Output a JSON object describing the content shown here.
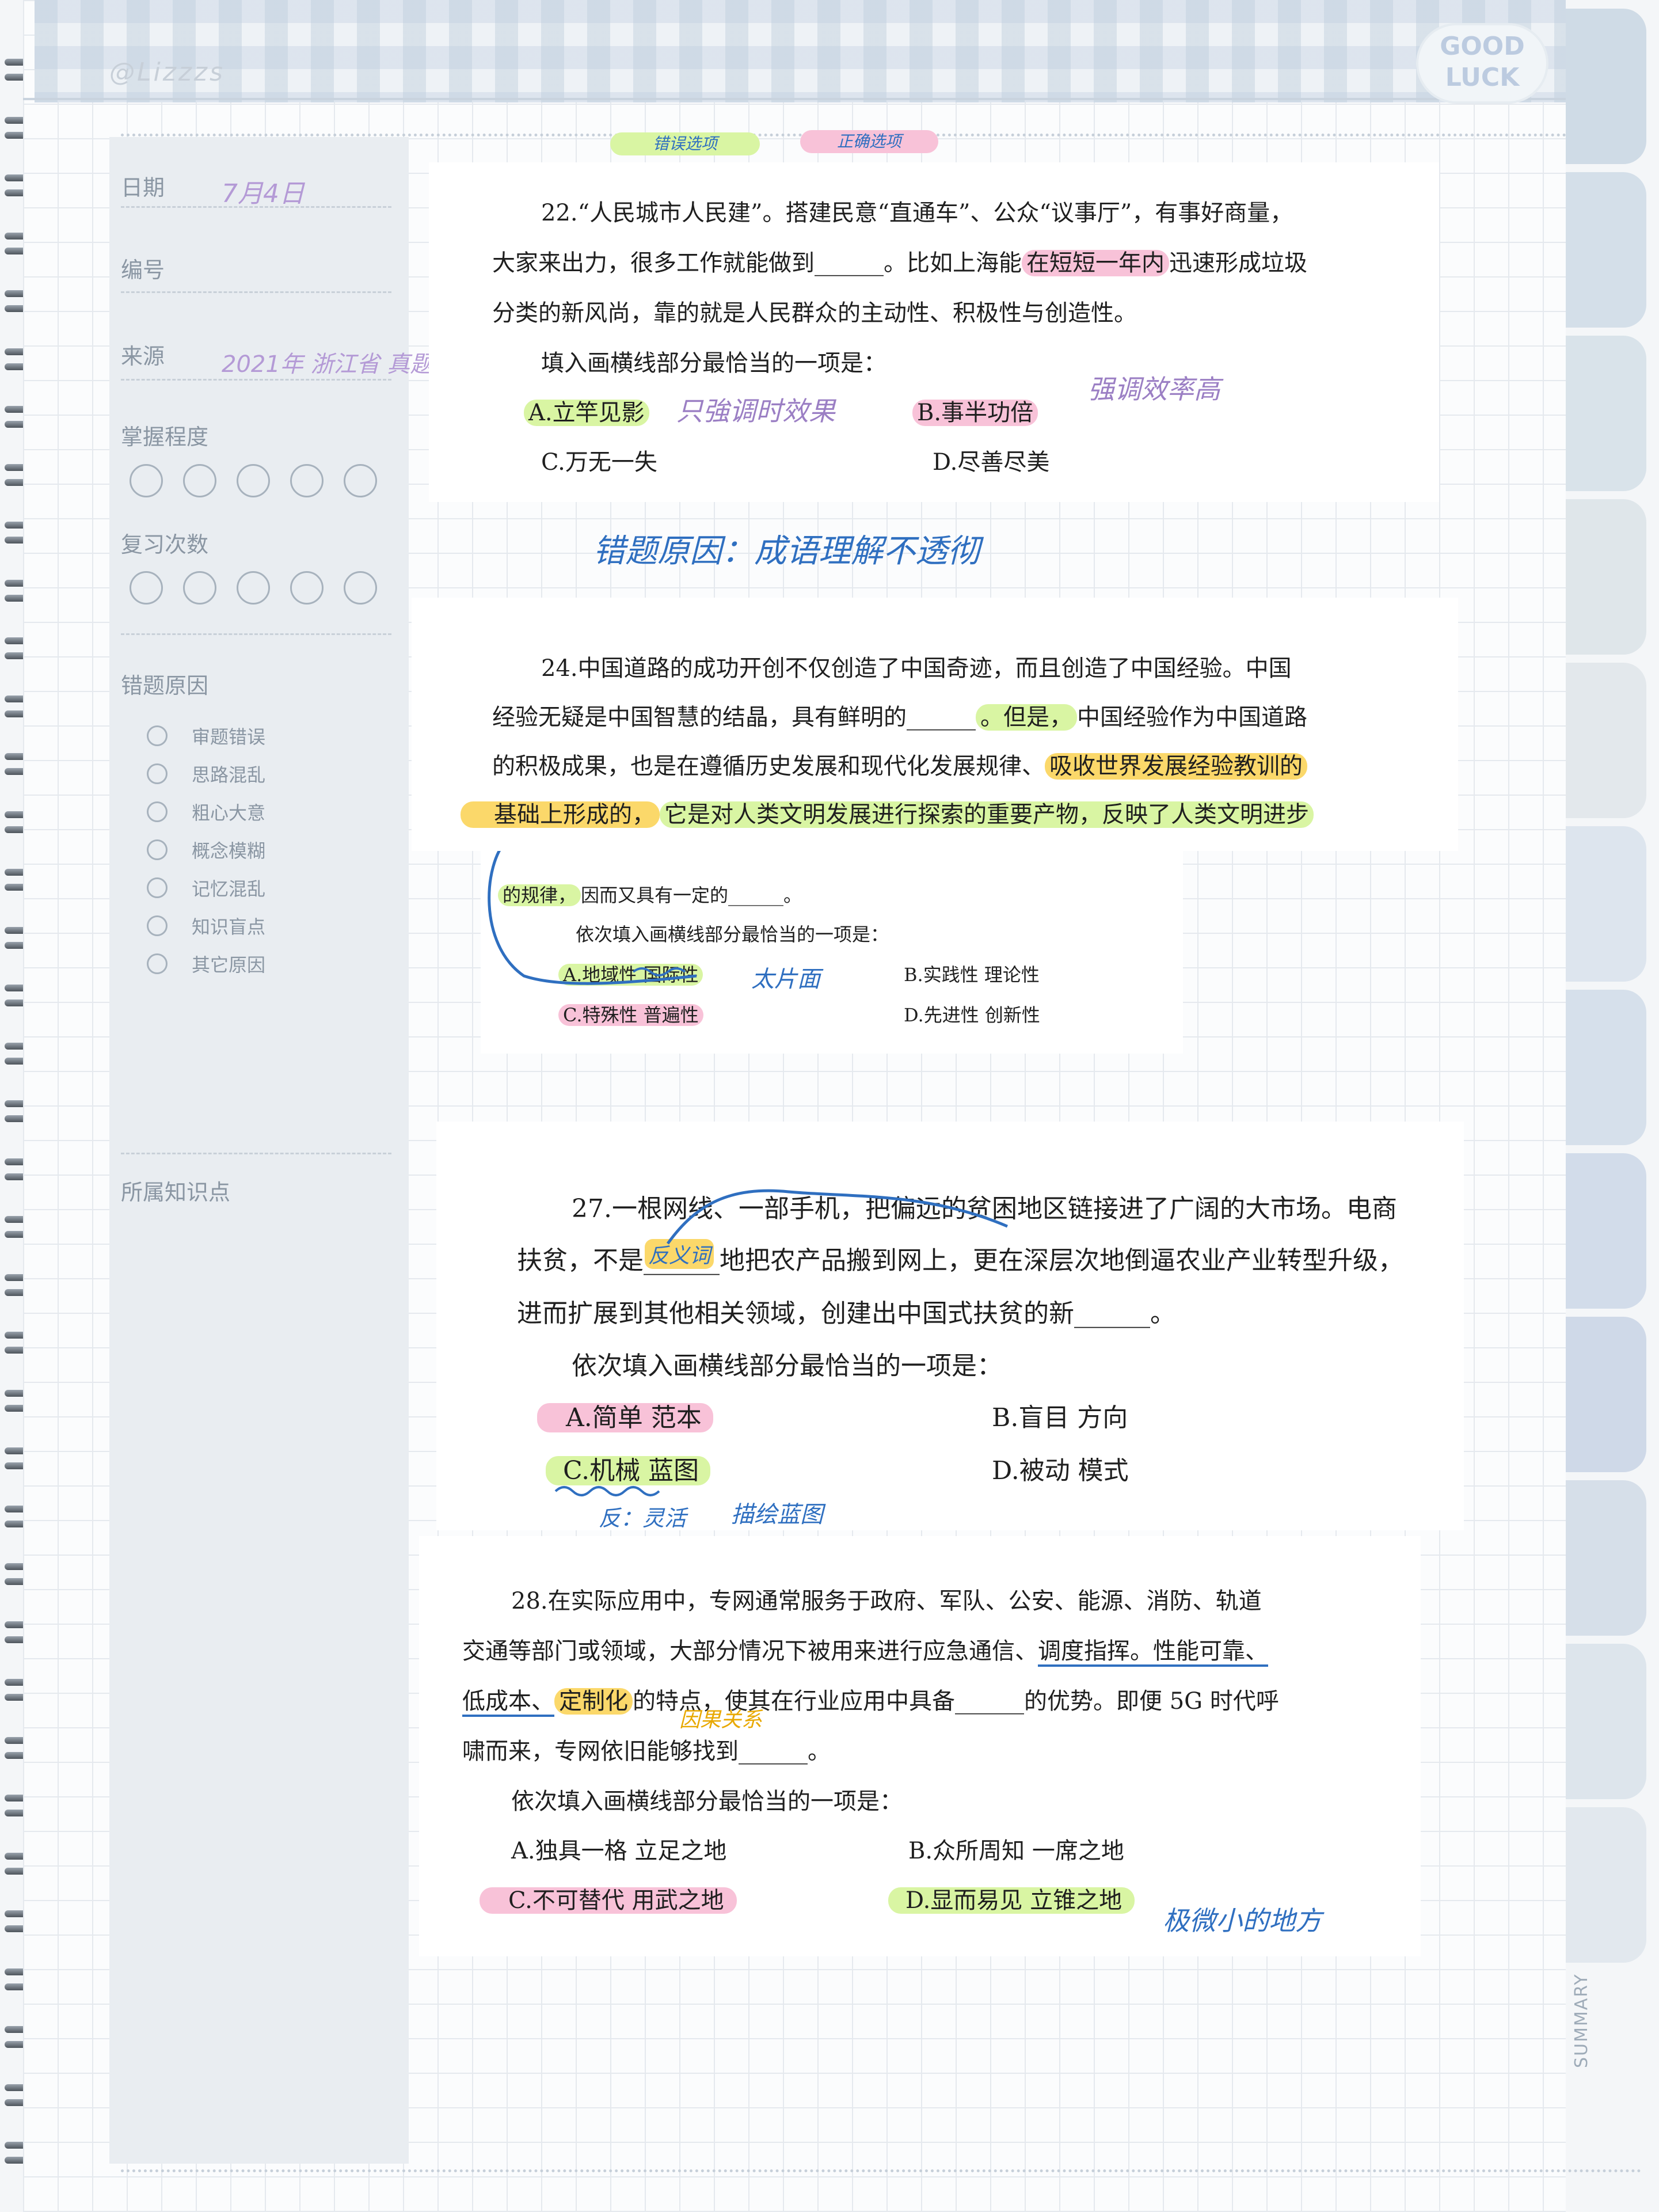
{
  "header": {
    "watermark": "@Lizzzs",
    "sticker": "GOOD LUCK",
    "legend": {
      "wrong_option": "错误选项",
      "correct_option": "正确选项"
    }
  },
  "sidebar": {
    "date_label": "日期",
    "date_value": "7月4日",
    "number_label": "编号",
    "source_label": "来源",
    "source_value": "2021年 浙江省 真题",
    "mastery_label": "掌握程度",
    "review_label": "复习次数",
    "reason_label": "错题原因",
    "reasons": [
      "审题错误",
      "思路混乱",
      "粗心大意",
      "概念模糊",
      "记忆混乱",
      "知识盲点",
      "其它原因"
    ],
    "knowledge_label": "所属知识点"
  },
  "q22": {
    "stem1": "22.“人民城市人民建”。搭建民意“直通车”、公众“议事厅”，有事好商量，",
    "stem2a": "大家来出力，很多工作就能做到______。比如上海能",
    "stem2hl": "在短短一年内",
    "stem2b": "迅速形成垃圾",
    "stem3": "分类的新风尚，靠的就是人民群众的主动性、积极性与创造性。",
    "prompt": "填入画横线部分最恰当的一项是：",
    "optA": "A.立竿见影",
    "optB": "B.事半功倍",
    "optC": "C.万无一失",
    "optD": "D.尽善尽美",
    "noteA": "只強调时效果",
    "noteB": "强调效率高",
    "wrong_reason": "错题原因：成语理解不透彻"
  },
  "q24": {
    "stem1": "24.中国道路的成功开创不仅创造了中国奇迹，而且创造了中国经验。中国",
    "stem2a": "经验无疑是中国智慧的结晶，具有鲜明的______",
    "stem2hl": "。但是，",
    "stem2b": "中国经验作为中国道路",
    "stem3a": "的积极成果，也是在遵循历史发展和现代化发展规律、",
    "stem3hl": "吸收世界发展经验教训的",
    "stem4y": "基础上形成的，",
    "stem4g": "它是对人类文明发展进行探索的重要产物，反映了人类文明进步",
    "stem5hl": "的规律，",
    "stem5b": "因而又具有一定的______。",
    "prompt": "依次填入画横线部分最恰当的一项是：",
    "optA": "A.地域性  国际性",
    "optB": "B.实践性  理论性",
    "optC": "C.特殊性  普遍性",
    "optD": "D.先进性  创新性",
    "noteA": "太片面"
  },
  "q27": {
    "stem1": "27.一根网线、一部手机，把偏远的贫困地区链接进了广阔的大市场。电商",
    "stem2": "扶贫，不是______地把农产品搬到网上，更在深层次地倒逼农业产业转型升级，",
    "stem3": "进而扩展到其他相关领域，创建出中国式扶贫的新______。",
    "prompt": "依次填入画横线部分最恰当的一项是：",
    "optA": "A.简单  范本",
    "optB": "B.盲目  方向",
    "optC": "C.机械  蓝图",
    "optD": "D.被动  模式",
    "note_blank": "反义词",
    "noteC1": "反：灵活",
    "noteC2": "描绘蓝图"
  },
  "q28": {
    "stem1": "28.在实际应用中，专网通常服务于政府、军队、公安、能源、消防、轨道",
    "stem2a": "交通等部门或领域，大部分情况下被用来进行应急通信、",
    "stem2u": "调度指挥。性能可靠、",
    "stem3a": "低成本、",
    "stem3hl": "定制化",
    "stem3b": "的特点，使其在行业应用中具备______的优势。即便 5G 时代呼",
    "stem4": "啸而来，专网依旧能够找到______。",
    "prompt": "依次填入画横线部分最恰当的一项是：",
    "optA": "A.独具一格  立足之地",
    "optB": "B.众所周知  一席之地",
    "optC": "C.不可替代  用武之地",
    "optD": "D.显而易见  立锥之地",
    "note_cause": "因果关系",
    "noteD": "极微小的地方"
  },
  "tabs": {
    "summary_label": "SUMMARY"
  },
  "colors": {
    "highlight_green": "#d9f5a3",
    "highlight_pink": "#f8c2d8",
    "highlight_yellow": "#fbd86a",
    "ink_blue": "#2f6fc0",
    "ink_purple": "#9b7fc4"
  }
}
